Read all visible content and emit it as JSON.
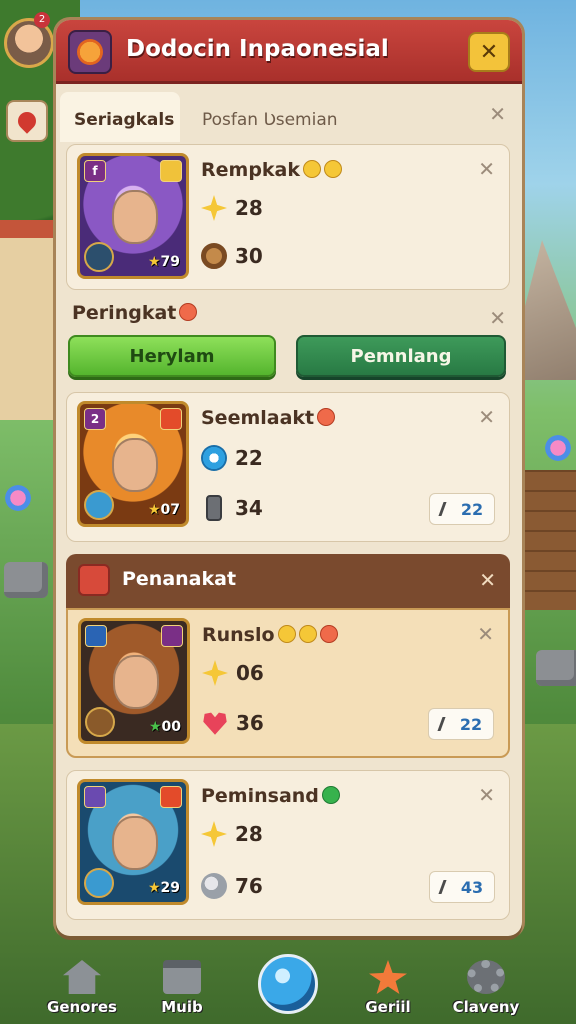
{
  "header": {
    "title": "Dodocin Inpaonesial",
    "close_label": "✕"
  },
  "tabs": [
    {
      "label": "Seriagkals"
    },
    {
      "label": "Posfan Ʋsemian"
    }
  ],
  "cards": [
    {
      "name": "Rempkak",
      "rating": "79",
      "stat1": "28",
      "stat2": "30"
    },
    {
      "name": "Seemlaakt",
      "rank_badge": "2",
      "rating": "07",
      "stat1": "22",
      "stat2": "34",
      "pill": "22"
    },
    {
      "name": "Runslo",
      "rating": "00",
      "stat1": "06",
      "stat2": "36",
      "pill": "22"
    },
    {
      "name": "Peminsand",
      "rating": "29",
      "stat1": "28",
      "stat2": "76",
      "pill": "43"
    }
  ],
  "section": {
    "label": "Peringkat",
    "btn_left": "Herylam",
    "btn_right": "Pemnlang"
  },
  "group": {
    "title": "Penanakat"
  },
  "nav": {
    "items": [
      "Genores",
      "Muib",
      "Geriil",
      "Claveny"
    ]
  },
  "avatar_badge": "2",
  "colors": {
    "title_red": "#c9453e",
    "close_yellow": "#f3c33a",
    "btn_green_light": "#6fca3f",
    "btn_green_dark": "#2f8a4e",
    "panel_bg": "#efe4cf"
  }
}
